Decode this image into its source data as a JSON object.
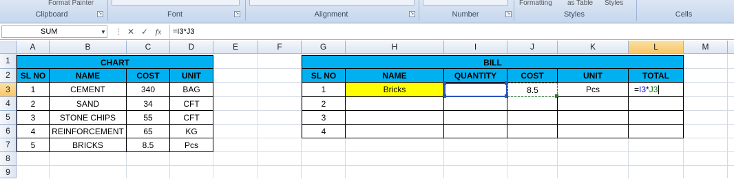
{
  "ribbon": {
    "groups": [
      "Clipboard",
      "Font",
      "Alignment",
      "Number",
      "Styles",
      "Cells"
    ],
    "fragments": {
      "format_painter": "Format Painter",
      "formatting": "Formatting",
      "as_table": "as Table",
      "styles_btn": "Styles"
    }
  },
  "formula_bar": {
    "name_box": "SUM",
    "cancel_icon": "✕",
    "enter_icon": "✓",
    "fx": "fx",
    "formula": "=I3*J3"
  },
  "columns": [
    "A",
    "B",
    "C",
    "D",
    "E",
    "F",
    "G",
    "H",
    "I",
    "J",
    "K",
    "L",
    "M"
  ],
  "rows": [
    "1",
    "2",
    "3",
    "4",
    "5",
    "6",
    "7",
    "8",
    "9"
  ],
  "chart_table": {
    "title": "CHART",
    "headers": [
      "SL NO",
      "NAME",
      "COST",
      "UNIT"
    ],
    "rows": [
      [
        "1",
        "CEMENT",
        "340",
        "BAG"
      ],
      [
        "2",
        "SAND",
        "34",
        "CFT"
      ],
      [
        "3",
        "STONE CHIPS",
        "55",
        "CFT"
      ],
      [
        "4",
        "REINFORCEMENT",
        "65",
        "KG"
      ],
      [
        "5",
        "BRICKS",
        "8.5",
        "Pcs"
      ]
    ]
  },
  "bill_table": {
    "title": "BILL",
    "headers": [
      "SL NO",
      "NAME",
      "QUANTITY",
      "COST",
      "UNIT",
      "TOTAL"
    ],
    "rows": [
      [
        "1",
        "Bricks",
        "",
        "8.5",
        "Pcs",
        ""
      ],
      [
        "2",
        "",
        "",
        "",
        "",
        ""
      ],
      [
        "3",
        "",
        "",
        "",
        "",
        ""
      ],
      [
        "4",
        "",
        "",
        "",
        "",
        ""
      ]
    ],
    "editing_cell": {
      "eq": "=",
      "ref1": "I3",
      "op": "*",
      "ref2": "J3"
    }
  },
  "colors": {
    "header_fill": "#00b0f0",
    "highlight_fill": "#ffff00",
    "ref1_color": "#0000ff",
    "ref2_color": "#008000"
  }
}
